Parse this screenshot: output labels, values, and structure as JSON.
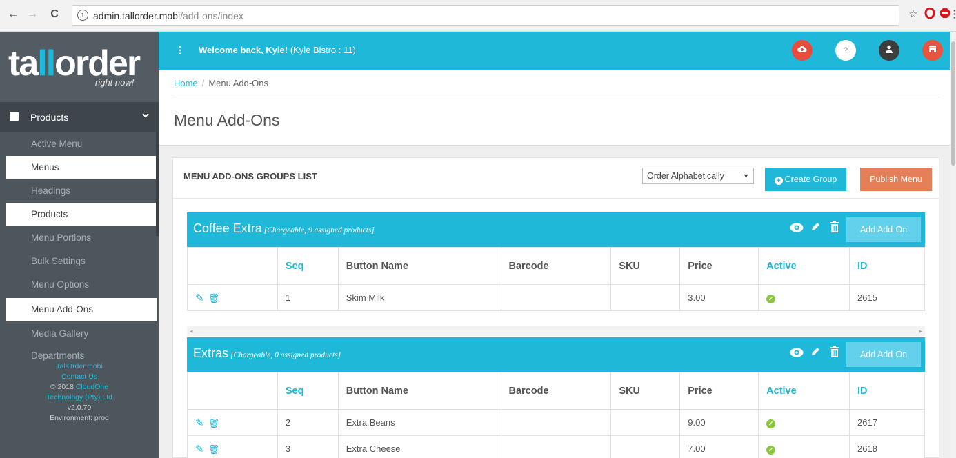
{
  "browser": {
    "back_icon": "←",
    "forward_icon": "→",
    "reload_icon": "C",
    "info_icon": "i",
    "url_host": "admin.tallorder.mobi",
    "url_path": "/add-ons/index",
    "star_icon": "☆",
    "menu_icon": "⋮"
  },
  "brand": {
    "logo_part1": "ta",
    "logo_part2": "ll",
    "logo_part3": "order",
    "tagline": "right now!"
  },
  "sidebar": {
    "section": "Products",
    "items": [
      {
        "label": "Active Menu",
        "active": false
      },
      {
        "label": "Menus",
        "active": true
      },
      {
        "label": "Headings",
        "active": false
      },
      {
        "label": "Products",
        "active": true
      },
      {
        "label": "Menu Portions",
        "active": false
      },
      {
        "label": "Bulk Settings",
        "active": false
      },
      {
        "label": "Menu Options",
        "active": false
      },
      {
        "label": "Menu Add-Ons",
        "active": true
      },
      {
        "label": "Media Gallery",
        "active": false
      },
      {
        "label": "Departments",
        "active": false
      }
    ],
    "footer": {
      "site": "TallOrder.mobi",
      "contact": "Contact Us",
      "copyright": "© 2018",
      "company_a": "CloudOne",
      "company_b": "Technology (Pty) Ltd",
      "version": "v2.0.70",
      "environment": "Environment: prod"
    }
  },
  "topbar": {
    "welcome_bold": "Welcome back, Kyle!",
    "welcome_rest": " (Kyle Bistro : 11)",
    "help_label": "?",
    "colors": {
      "upload": "#e84c3d",
      "help": "#ffffff",
      "user": "#3d3d3d",
      "store": "#e8553e"
    }
  },
  "breadcrumb": {
    "home": "Home",
    "current": "Menu Add-Ons"
  },
  "page_title": "Menu Add-Ons",
  "panel": {
    "title": "MENU ADD-ONS GROUPS LIST",
    "sort_value": "Order Alphabetically",
    "create_label": "Create Group",
    "publish_label": "Publish Menu"
  },
  "columns": [
    "",
    "Seq",
    "Button Name",
    "Barcode",
    "SKU",
    "Price",
    "Active",
    "ID"
  ],
  "groups": [
    {
      "name": "Coffee Extra",
      "meta": "[Chargeable, 9 assigned products]",
      "add_label": "Add Add-On",
      "rows": [
        {
          "seq": "1",
          "name": "Skim Milk",
          "barcode": "",
          "sku": "",
          "price": "3.00",
          "id": "2615"
        }
      ]
    },
    {
      "name": "Extras",
      "meta": "[Chargeable, 0 assigned products]",
      "add_label": "Add Add-On",
      "rows": [
        {
          "seq": "2",
          "name": "Extra Beans",
          "barcode": "",
          "sku": "",
          "price": "9.00",
          "id": "2617"
        },
        {
          "seq": "3",
          "name": "Extra Cheese",
          "barcode": "",
          "sku": "",
          "price": "7.00",
          "id": "2618"
        }
      ]
    }
  ]
}
